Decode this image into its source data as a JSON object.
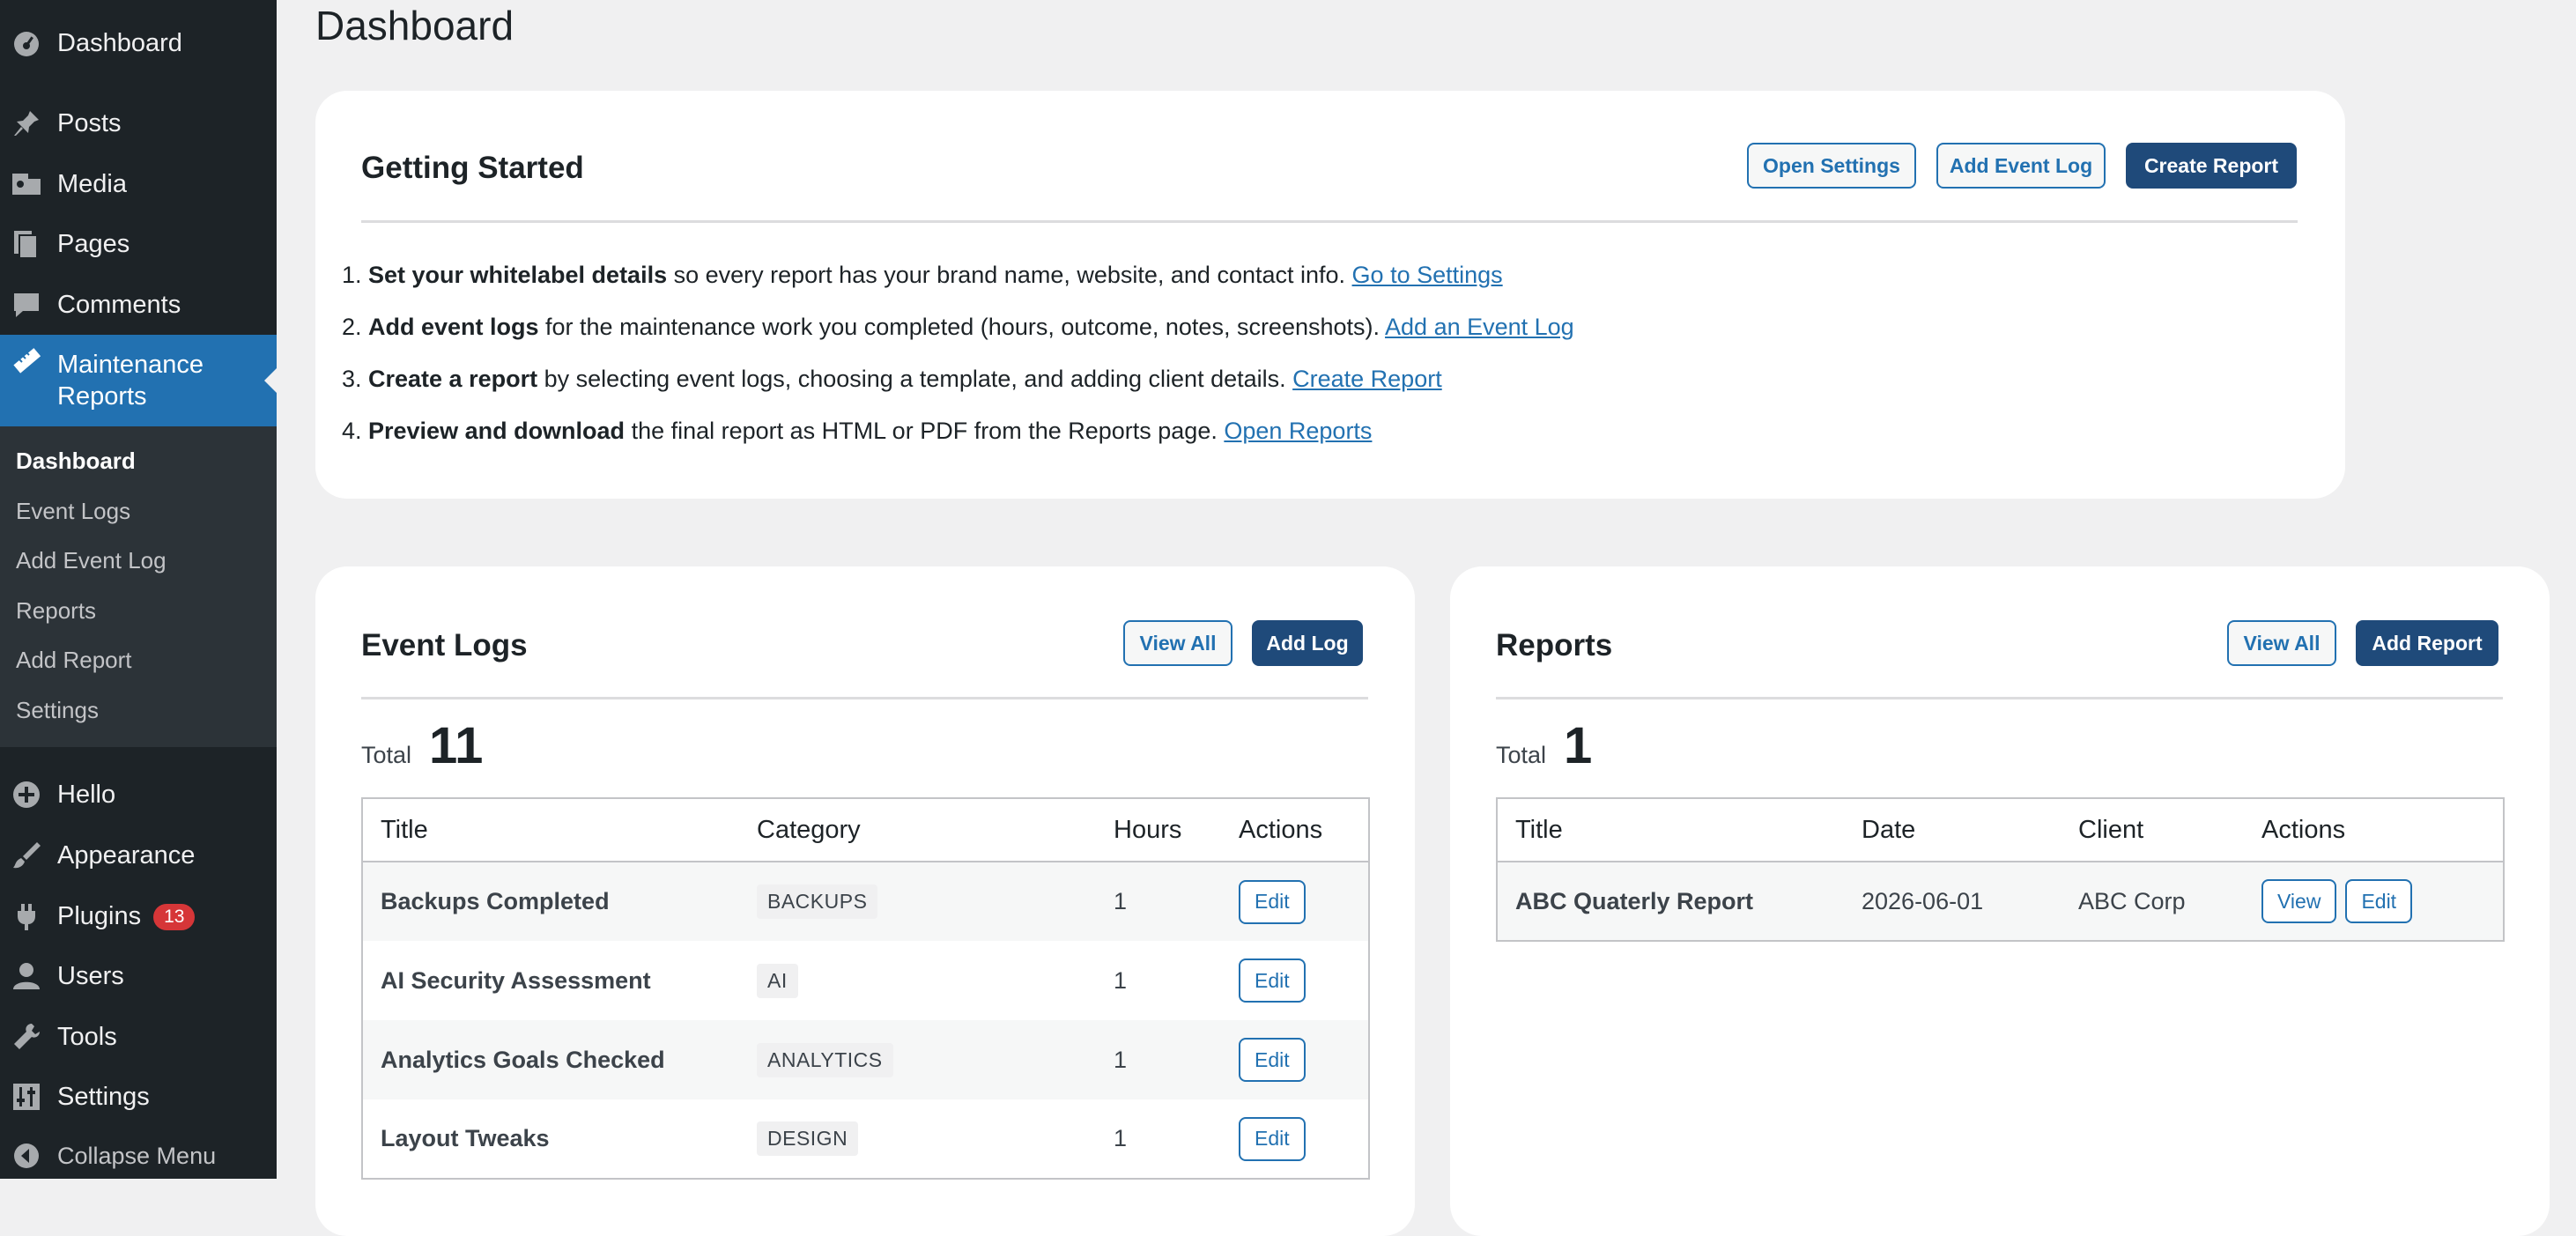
{
  "sidebar": {
    "menu": {
      "dashboard": "Dashboard",
      "posts": "Posts",
      "media": "Media",
      "pages": "Pages",
      "comments": "Comments",
      "maintenance_reports": "Maintenance Reports",
      "hello": "Hello",
      "appearance": "Appearance",
      "plugins": "Plugins",
      "plugins_badge": "13",
      "users": "Users",
      "tools": "Tools",
      "settings": "Settings",
      "collapse": "Collapse Menu"
    },
    "submenu": [
      "Dashboard",
      "Event Logs",
      "Add Event Log",
      "Reports",
      "Add Report",
      "Settings"
    ]
  },
  "page_title": "Dashboard",
  "getting_started": {
    "title": "Getting Started",
    "buttons": {
      "open_settings": "Open Settings",
      "add_event_log": "Add Event Log",
      "create_report": "Create Report"
    },
    "steps": [
      {
        "num": "1.",
        "bold": "Set your whitelabel details",
        "text": " so every report has your brand name, website, and contact info. ",
        "link": "Go to Settings"
      },
      {
        "num": "2.",
        "bold": "Add event logs",
        "text": " for the maintenance work you completed (hours, outcome, notes, screenshots). ",
        "link": "Add an Event Log"
      },
      {
        "num": "3.",
        "bold": "Create a report",
        "text": " by selecting event logs, choosing a template, and adding client details. ",
        "link": "Create Report"
      },
      {
        "num": "4.",
        "bold": "Preview and download",
        "text": " the final report as HTML or PDF from the Reports page. ",
        "link": "Open Reports"
      }
    ]
  },
  "event_logs": {
    "title": "Event Logs",
    "view_all": "View All",
    "add": "Add Log",
    "total_label": "Total",
    "total": "11",
    "columns": [
      "Title",
      "Category",
      "Hours",
      "Actions"
    ],
    "rows": [
      {
        "title": "Backups Completed",
        "category": "BACKUPS",
        "hours": "1",
        "action": "Edit"
      },
      {
        "title": "AI Security Assessment",
        "category": "AI",
        "hours": "1",
        "action": "Edit"
      },
      {
        "title": "Analytics Goals Checked",
        "category": "ANALYTICS",
        "hours": "1",
        "action": "Edit"
      },
      {
        "title": "Layout Tweaks",
        "category": "DESIGN",
        "hours": "1",
        "action": "Edit"
      }
    ]
  },
  "reports": {
    "title": "Reports",
    "view_all": "View All",
    "add": "Add Report",
    "total_label": "Total",
    "total": "1",
    "columns": [
      "Title",
      "Date",
      "Client",
      "Actions"
    ],
    "rows": [
      {
        "title": "ABC Quaterly Report",
        "date": "2026-06-01",
        "client": "ABC Corp",
        "view": "View",
        "edit": "Edit"
      }
    ]
  },
  "colors": {
    "sidebar_bg": "#1d2327",
    "submenu_bg": "#2c3338",
    "accent": "#2271b1",
    "primary_button": "#1f4a7a",
    "badge": "#d63638"
  }
}
